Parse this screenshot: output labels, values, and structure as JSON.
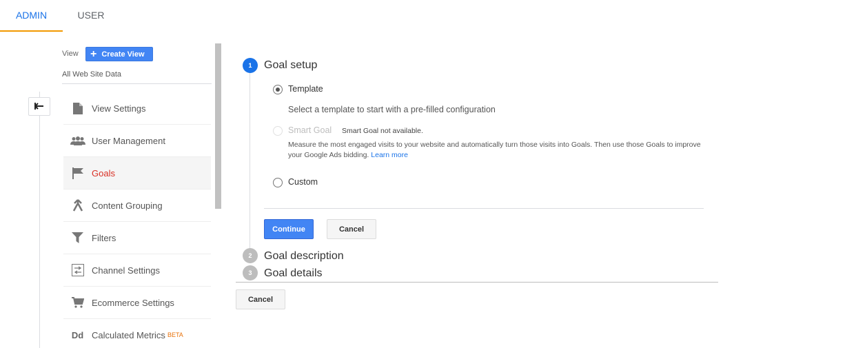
{
  "tabs": {
    "admin": "ADMIN",
    "user": "USER"
  },
  "view": {
    "label": "View",
    "create_button": "Create View",
    "name": "All Web Site Data"
  },
  "menu": {
    "items": [
      {
        "label": "View Settings",
        "icon": "document-icon"
      },
      {
        "label": "User Management",
        "icon": "people-icon"
      },
      {
        "label": "Goals",
        "icon": "flag-icon",
        "active": true
      },
      {
        "label": "Content Grouping",
        "icon": "merge-icon"
      },
      {
        "label": "Filters",
        "icon": "filter-icon"
      },
      {
        "label": "Channel Settings",
        "icon": "channel-icon"
      },
      {
        "label": "Ecommerce Settings",
        "icon": "cart-icon"
      },
      {
        "label": "Calculated Metrics",
        "icon": "dd-icon",
        "icon_text": "Dd",
        "badge": "BETA"
      }
    ]
  },
  "goal_setup": {
    "steps": [
      {
        "number": "1",
        "title": "Goal setup"
      },
      {
        "number": "2",
        "title": "Goal description"
      },
      {
        "number": "3",
        "title": "Goal details"
      }
    ],
    "template": {
      "label": "Template",
      "description": "Select a template to start with a pre-filled configuration"
    },
    "smart_goal": {
      "label": "Smart Goal",
      "note": "Smart Goal not available.",
      "description": "Measure the most engaged visits to your website and automatically turn those visits into Goals. Then use those Goals to improve your Google Ads bidding.",
      "link": "Learn more"
    },
    "custom": {
      "label": "Custom"
    },
    "continue_button": "Continue",
    "cancel_button": "Cancel"
  },
  "footer": {
    "cancel_button": "Cancel"
  },
  "colors": {
    "accent": "#1a73e8",
    "primary_button": "#4285f4",
    "active_item": "#d93025",
    "tab_underline": "#f29900"
  }
}
